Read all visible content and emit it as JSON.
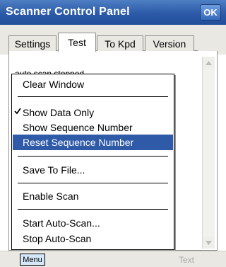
{
  "window": {
    "title": "Scanner Control Panel",
    "ok_label": "OK"
  },
  "tabs": [
    {
      "label": "Settings",
      "active": false
    },
    {
      "label": "Test",
      "active": true
    },
    {
      "label": "To Kpd",
      "active": false
    },
    {
      "label": "Version",
      "active": false
    }
  ],
  "content": {
    "log_text": "auto scan stopped"
  },
  "context_menu": {
    "items": {
      "clear_window": "Clear Window",
      "show_data_only": "Show Data Only",
      "show_sequence_number": "Show Sequence Number",
      "reset_sequence_number": "Reset Sequence Number",
      "save_to_file": "Save To File...",
      "enable_scan": "Enable Scan",
      "start_auto_scan": "Start Auto-Scan...",
      "stop_auto_scan": "Stop Auto-Scan"
    },
    "checked_item": "show_data_only",
    "highlighted_item": "reset_sequence_number",
    "checkmark_icon": "checkmark-icon",
    "highlight_color": "#2f5aa8"
  },
  "bottom_bar": {
    "menu_label": "Menu",
    "text_label": "Text"
  },
  "colors": {
    "titlebar": "#2c5aa8",
    "tab_background": "#e9e8e3"
  }
}
